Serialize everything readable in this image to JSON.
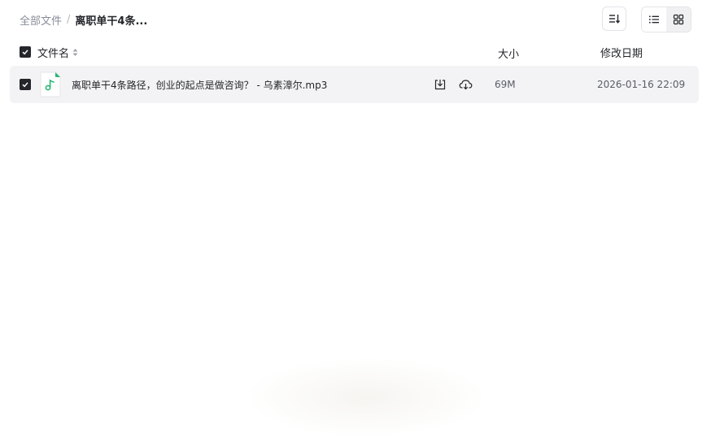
{
  "breadcrumb": {
    "root": "全部文件",
    "separator": "/",
    "current": "离职单干4条..."
  },
  "toolbar": {
    "sort_icon": "sort-icon",
    "list_view_icon": "list-view-icon",
    "grid_view_icon": "grid-view-icon",
    "active_view": "list"
  },
  "table": {
    "columns": {
      "name": "文件名",
      "size": "大小",
      "date": "修改日期"
    },
    "rows": [
      {
        "checked": true,
        "icon": "audio-file-icon",
        "name": "离职单干4条路径，创业的起点是做咨询？ - 乌素漳尔.mp3",
        "size": "69M",
        "date": "2026-01-16 22:09"
      }
    ]
  },
  "colors": {
    "text": "#25262b",
    "muted": "#8a8c99",
    "row_bg": "#f3f3f5",
    "audio_green": "#2bb673"
  }
}
